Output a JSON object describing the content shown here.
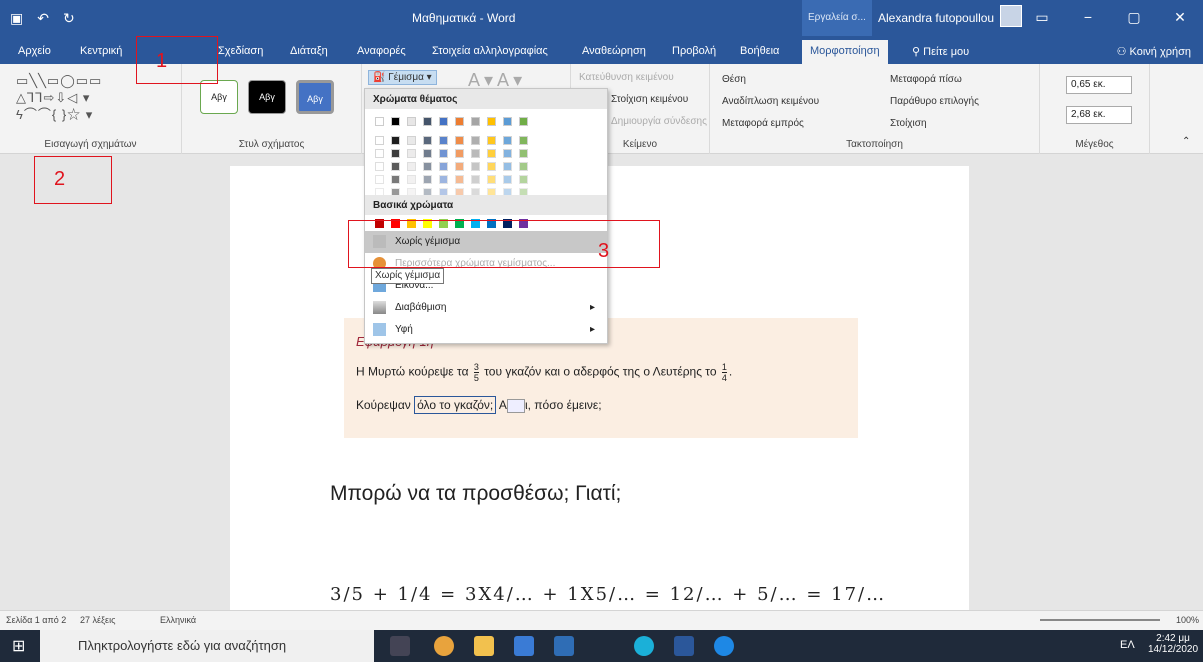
{
  "window": {
    "title": "Μαθηματικά - Word",
    "context_tab": "Εργαλεία σ...",
    "user": "Alexandra futopoullou"
  },
  "tabs": [
    "Αρχείο",
    "Κεντρική",
    "Σχεδίαση",
    "Διάταξη",
    "Αναφορές",
    "Στοιχεία αλληλογραφίας",
    "Αναθεώρηση",
    "Προβολή",
    "Βοήθεια",
    "Μορφοποίηση",
    "Πείτε μου",
    "Κοινή χρήση"
  ],
  "ribbon": {
    "insert_shapes": "Εισαγωγή σχημάτων",
    "shape_styles": "Στυλ σχήματος",
    "style_sample": "Αβγ",
    "fill_button": "Γέμισμα",
    "text_group": "Κείμενο",
    "text_items": [
      "Κατεύθυνση κειμένου",
      "Στοίχιση κειμένου",
      "Δημιουργία σύνδεσης"
    ],
    "arrange_group": "Τακτοποίηση",
    "arrange_items": [
      "Θέση",
      "Αναδίπλωση κειμένου",
      "Μεταφορά εμπρός",
      "Μεταφορά πίσω",
      "Παράθυρο επιλογής",
      "Στοίχιση"
    ],
    "size_group": "Μέγεθος",
    "height": "0,65 εκ.",
    "width": "2,68 εκ."
  },
  "dropdown": {
    "theme_colors": "Χρώματα θέματος",
    "standard_colors": "Βασικά χρώματα",
    "no_fill": "Χωρίς γέμισμα",
    "more_colors": "Περισσότερα χρώματα γεμίσματος...",
    "picture": "Εικόνα...",
    "gradient": "Διαβάθμιση",
    "texture": "Υφή",
    "tooltip": "Χωρίς γέμισμα"
  },
  "document": {
    "heading": "Εφαρμογή 1η",
    "line1_a": "Η Μυρτώ κούρεψε τα",
    "line1_b": "του γκαζόν και ο αδερφός της ο Λευτέρης το",
    "line2_a": "Κούρεψαν",
    "line2_sel": "όλο το γκαζόν;",
    "line2_b": "Α",
    "line2_c": "ι, πόσο έμεινε;",
    "big_text": "Μπορώ να τα προσθέσω; Γιατί;",
    "equation": "3/5 + 1/4 = 3X4/… + 1X5/… = 12/… + 5/… = 17/…"
  },
  "fractions": {
    "f1n": "3",
    "f1d": "5",
    "f2n": "1",
    "f2d": "4"
  },
  "status": {
    "page": "Σελίδα 1 από 2",
    "words": "27 λέξεις",
    "lang": "Ελληνικά",
    "zoom": "100%"
  },
  "taskbar": {
    "search": "Πληκτρολογήστε εδώ για αναζήτηση",
    "time": "2:42 μμ",
    "date": "14/12/2020",
    "lang": "ΕΛ"
  },
  "annotations": [
    "1",
    "2",
    "3"
  ],
  "colors": {
    "accent": "#2b579a",
    "annotation": "#e0141e",
    "note_bg": "#fbeee2"
  }
}
